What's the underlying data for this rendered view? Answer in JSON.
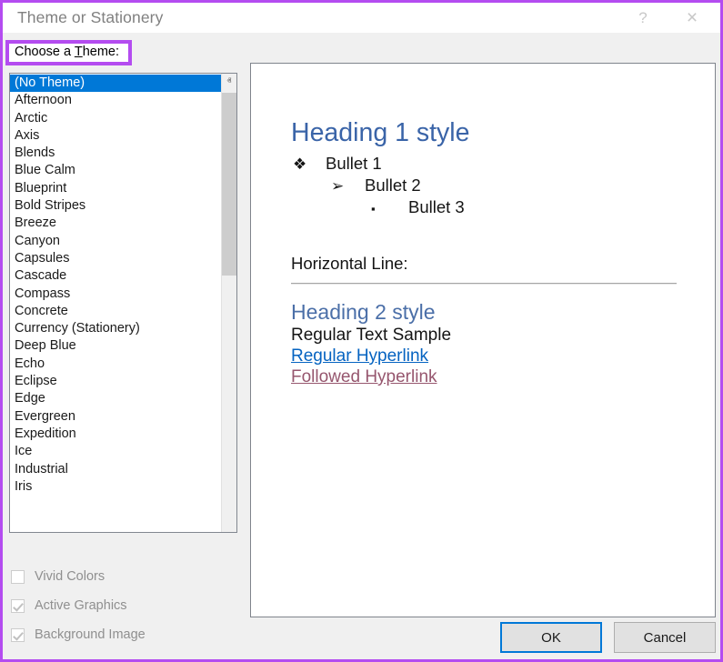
{
  "window": {
    "title": "Theme or Stationery",
    "help_icon": "?",
    "close_icon": "×",
    "border_color": "#b44cf0"
  },
  "left_panel": {
    "choose_label_prefix": "Choose a ",
    "choose_label_accel": "T",
    "choose_label_suffix": "heme:",
    "highlight_color": "#b44cf0",
    "selection_color": "#0078d7",
    "themes": [
      "(No Theme)",
      "Afternoon",
      "Arctic",
      "Axis",
      "Blends",
      "Blue Calm",
      "Blueprint",
      "Bold Stripes",
      "Breeze",
      "Canyon",
      "Capsules",
      "Cascade",
      "Compass",
      "Concrete",
      "Currency (Stationery)",
      "Deep Blue",
      "Echo",
      "Eclipse",
      "Edge",
      "Evergreen",
      "Expedition",
      "Ice",
      "Industrial",
      "Iris"
    ],
    "selected_theme": "(No Theme)",
    "scroll_up_icon": "ⱏ",
    "scroll_down_icon": "ⱟ",
    "checkboxes": [
      {
        "label": "Vivid Colors",
        "checked": false,
        "disabled": true
      },
      {
        "label": "Active Graphics",
        "checked": true,
        "disabled": true
      },
      {
        "label": "Background Image",
        "checked": true,
        "disabled": true
      }
    ]
  },
  "preview": {
    "heading1": "Heading 1 style",
    "bullets": [
      {
        "marker": "❖",
        "text": "Bullet 1"
      },
      {
        "marker": "➢",
        "text": "Bullet 2"
      },
      {
        "marker": "▪",
        "text": "Bullet 3"
      }
    ],
    "horizontal_line_label": "Horizontal Line:",
    "heading2": "Heading 2 style",
    "regular_text": "Regular Text Sample",
    "hyperlink": "Regular Hyperlink",
    "followed_hyperlink": "Followed Hyperlink",
    "colors": {
      "heading1": "#3a64a8",
      "heading2": "#4b6fa8",
      "hyperlink": "#0563c1",
      "followed_hyperlink": "#96566e"
    }
  },
  "footer": {
    "ok_label": "OK",
    "cancel_label": "Cancel",
    "focus_color": "#0078d7"
  }
}
